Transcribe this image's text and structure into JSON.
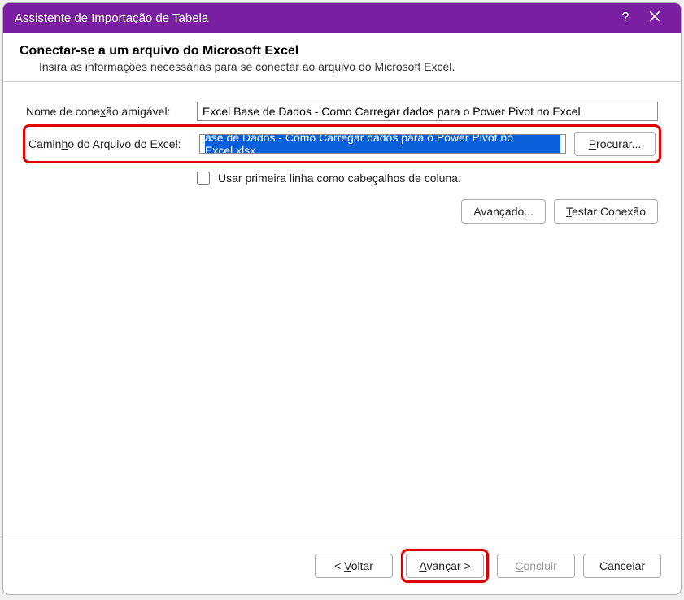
{
  "titlebar": {
    "title": "Assistente de Importação de Tabela"
  },
  "header": {
    "title": "Conectar-se a um arquivo do Microsoft Excel",
    "subtitle": "Insira as informações necessárias para se conectar ao arquivo do Microsoft Excel."
  },
  "labels": {
    "friendly_name_pre": "Nome de cone",
    "friendly_name_u": "x",
    "friendly_name_post": "ão amigável:",
    "file_path_pre": "Camin",
    "file_path_u": "h",
    "file_path_post": "o do Arquivo do Excel:",
    "first_row_pre": "U",
    "first_row_u": "s",
    "first_row_post": "ar primeira linha como cabeçalhos de coluna."
  },
  "fields": {
    "friendly_name": "Excel Base de Dados - Como Carregar dados para o Power Pivot no Excel",
    "file_path_selected": "ase de Dados - Como Carregar dados para o Power Pivot no Excel.xlsx"
  },
  "buttons": {
    "browse_u": "P",
    "browse_post": "rocurar...",
    "advanced": "Avançado...",
    "test_conn_u": "T",
    "test_conn_post": "estar Conexão",
    "back_pre": "< ",
    "back_u": "V",
    "back_post": "oltar",
    "next_u": "A",
    "next_post": "vançar >",
    "finish_u": "C",
    "finish_post": "oncluir",
    "cancel": "Cancelar"
  }
}
